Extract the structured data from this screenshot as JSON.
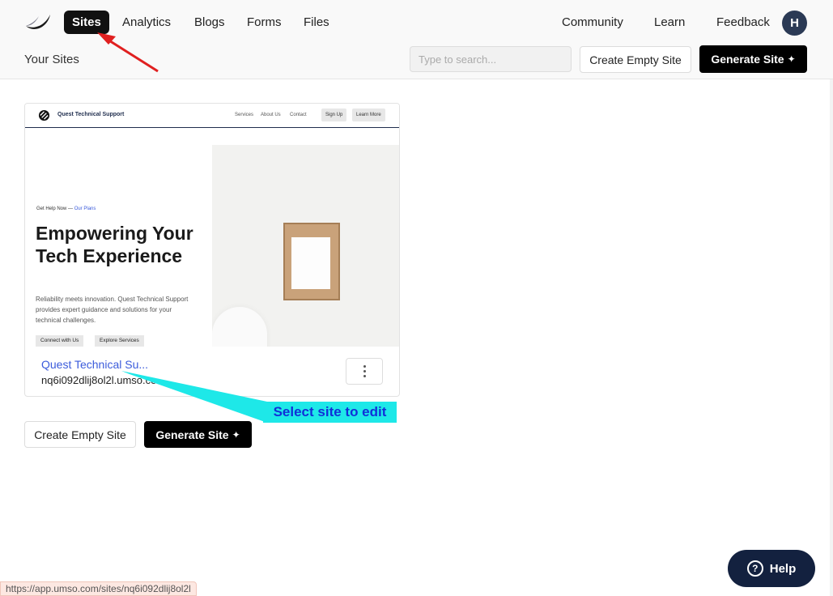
{
  "nav": {
    "items": [
      {
        "label": "Sites",
        "active": true
      },
      {
        "label": "Analytics"
      },
      {
        "label": "Blogs"
      },
      {
        "label": "Forms"
      },
      {
        "label": "Files"
      }
    ],
    "right": [
      {
        "label": "Community"
      },
      {
        "label": "Learn"
      },
      {
        "label": "Feedback"
      }
    ],
    "avatar_initial": "H",
    "logo_icon": "umso-logo-icon"
  },
  "toolbar": {
    "heading": "Your Sites",
    "search_placeholder": "Type to search...",
    "create_empty_label": "Create Empty Site",
    "generate_label": "Generate Site",
    "generate_icon": "sparkle-icon"
  },
  "site_card": {
    "name": "Quest Technical Su...",
    "subdomain": "nq6i092dlij8ol2l.umso.co",
    "preview": {
      "brand": "Quest Technical Support",
      "nav_links": [
        "Services",
        "About Us",
        "Contact"
      ],
      "nav_buttons": [
        "Sign Up",
        "Learn More"
      ],
      "eyebrow": "Get Help Now",
      "eyebrow_link": "Our Plans",
      "headline": "Empowering Your Tech Experience",
      "description": "Reliability meets innovation. Quest Technical Support provides expert guidance and solutions for your technical challenges.",
      "cta_buttons": [
        "Connect with Us",
        "Explore Services"
      ]
    }
  },
  "bottom_actions": {
    "create_empty_label": "Create Empty Site",
    "generate_label": "Generate Site"
  },
  "annotation": {
    "callout_text": "Select site to edit",
    "arrow_color": "#e02020",
    "callout_color": "#1ee8e8"
  },
  "help": {
    "label": "Help"
  },
  "status_url": "https://app.umso.com/sites/nq6i092dlij8ol2l"
}
